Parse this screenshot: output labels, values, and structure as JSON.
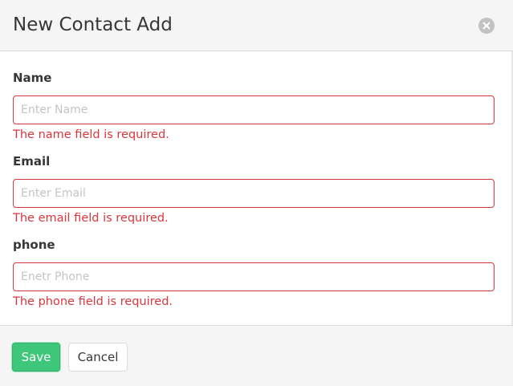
{
  "modal": {
    "title": "New Contact Add"
  },
  "fields": [
    {
      "label": "Name",
      "placeholder": "Enter Name",
      "value": "",
      "error": "The name field is required."
    },
    {
      "label": "Email",
      "placeholder": "Enter Email",
      "value": "",
      "error": "The email field is required."
    },
    {
      "label": "phone",
      "placeholder": "Enetr Phone",
      "value": "",
      "error": "The phone field is required."
    }
  ],
  "footer": {
    "save_label": "Save",
    "cancel_label": "Cancel"
  },
  "colors": {
    "error": "#d9363e",
    "save": "#3ec67b",
    "header_bg": "#f5f5f5"
  },
  "icons": {
    "close": "close-icon"
  }
}
